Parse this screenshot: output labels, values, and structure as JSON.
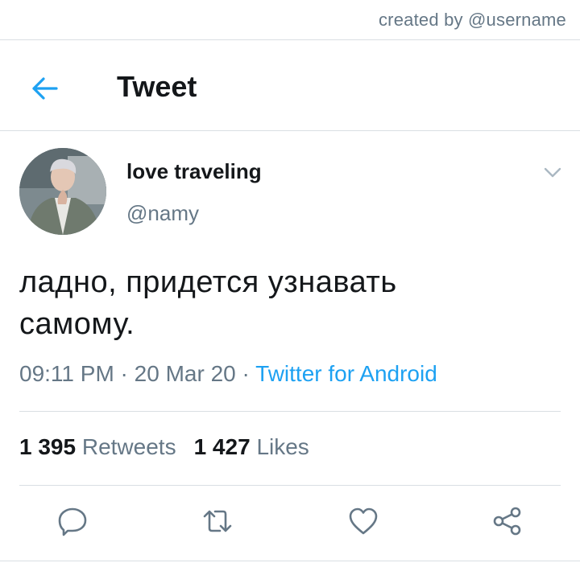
{
  "credit": "created by @username",
  "header": {
    "title": "Tweet",
    "back_icon": "arrow-left-icon"
  },
  "tweet": {
    "display_name": "love traveling",
    "handle": "@namy",
    "text_line1": "ладно, придется узнавать",
    "text_line2": "самому.",
    "time": "09:11 PM",
    "sep1": " · ",
    "date": "20 Mar 20",
    "sep2": " · ",
    "source": "Twitter for Android",
    "retweets_count": "1 395",
    "retweets_label": "Retweets",
    "likes_count": "1 427",
    "likes_label": "Likes"
  },
  "actions": [
    "reply-icon",
    "retweet-icon",
    "like-icon",
    "share-icon"
  ],
  "colors": {
    "accent": "#1da1f2",
    "muted": "#657786",
    "text": "#14171a",
    "divider": "#d9dfe3"
  }
}
